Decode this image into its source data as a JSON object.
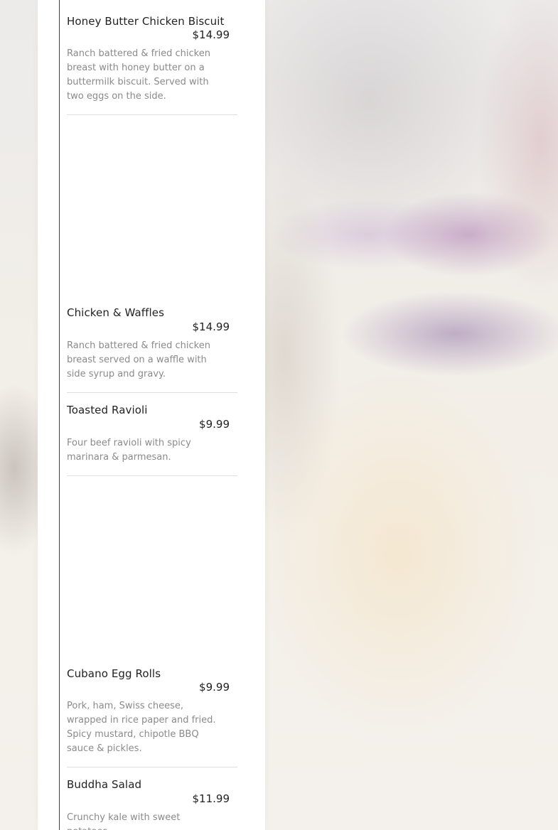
{
  "menu": {
    "items": [
      {
        "name": "Honey Butter Chicken Biscuit",
        "price": "$14.99",
        "description": "Ranch battered & fried chicken breast with honey butter on a buttermilk biscuit. Served with two eggs on the side."
      },
      {
        "name": "Chicken & Waffles",
        "price": "$14.99",
        "description": "Ranch battered & fried chicken breast served on a waffle with side syrup and gravy."
      },
      {
        "name": "Toasted Ravioli",
        "price": "$9.99",
        "description": "Four beef ravioli with spicy marinara & parmesan."
      },
      {
        "name": "Cubano Egg Rolls",
        "price": "$9.99",
        "description": "Pork, ham, Swiss cheese, wrapped in rice paper and fried. Spicy mustard, chipotle BBQ sauce & pickles."
      },
      {
        "name": "Buddha Salad",
        "price": "$11.99",
        "description": "Crunchy kale with sweet potatoes,"
      }
    ]
  },
  "colors": {
    "panel": "#ffffff",
    "text": "#222222",
    "description": "#8a8a8a",
    "rule": "#2f4a45",
    "divider": "#dedede"
  }
}
